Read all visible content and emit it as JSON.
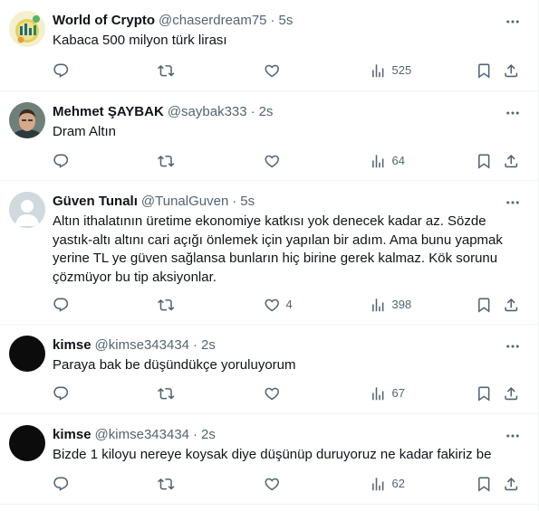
{
  "colors": {
    "text": "#0f1419",
    "secondary": "#536471",
    "border": "#eff3f4"
  },
  "icons": {
    "reply": "reply-icon",
    "retweet": "retweet-icon",
    "like": "heart-icon",
    "views": "views-chart-icon",
    "bookmark": "bookmark-icon",
    "share": "share-icon",
    "more": "more-dots-icon"
  },
  "tweets": [
    {
      "name": "World of Crypto",
      "handle": "@chaserdream75",
      "time": "5s",
      "text": "Kabaca 500 milyon türk lirası",
      "replies": "",
      "retweets": "",
      "likes": "",
      "views": "525"
    },
    {
      "name": "Mehmet ŞAYBAK",
      "handle": "@saybak333",
      "time": "2s",
      "text": "Dram Altın",
      "replies": "",
      "retweets": "",
      "likes": "",
      "views": "64"
    },
    {
      "name": "Güven Tunalı",
      "handle": "@TunalGuven",
      "time": "5s",
      "text": "Altın ithalatının üretime ekonomiye katkısı yok denecek kadar az. Sözde\nyastık-altı altını cari açığı önlemek için yapılan  bir adım. Ama bunu yapmak\nyerine TL ye güven sağlansa bunların hiç birine gerek kalmaz. Kök sorunu\nçözmüyor bu tip aksiyonlar.",
      "replies": "",
      "retweets": "",
      "likes": "4",
      "views": "398"
    },
    {
      "name": "kimse",
      "handle": "@kimse343434",
      "time": "2s",
      "text": "Paraya bak be düşündükçe yoruluyorum",
      "replies": "",
      "retweets": "",
      "likes": "",
      "views": "67"
    },
    {
      "name": "kimse",
      "handle": "@kimse343434",
      "time": "2s",
      "text": "Bizde 1 kiloyu nereye koysak diye düşünüp duruyoruz ne kadar fakiriz be",
      "replies": "",
      "retweets": "",
      "likes": "",
      "views": "62"
    }
  ]
}
